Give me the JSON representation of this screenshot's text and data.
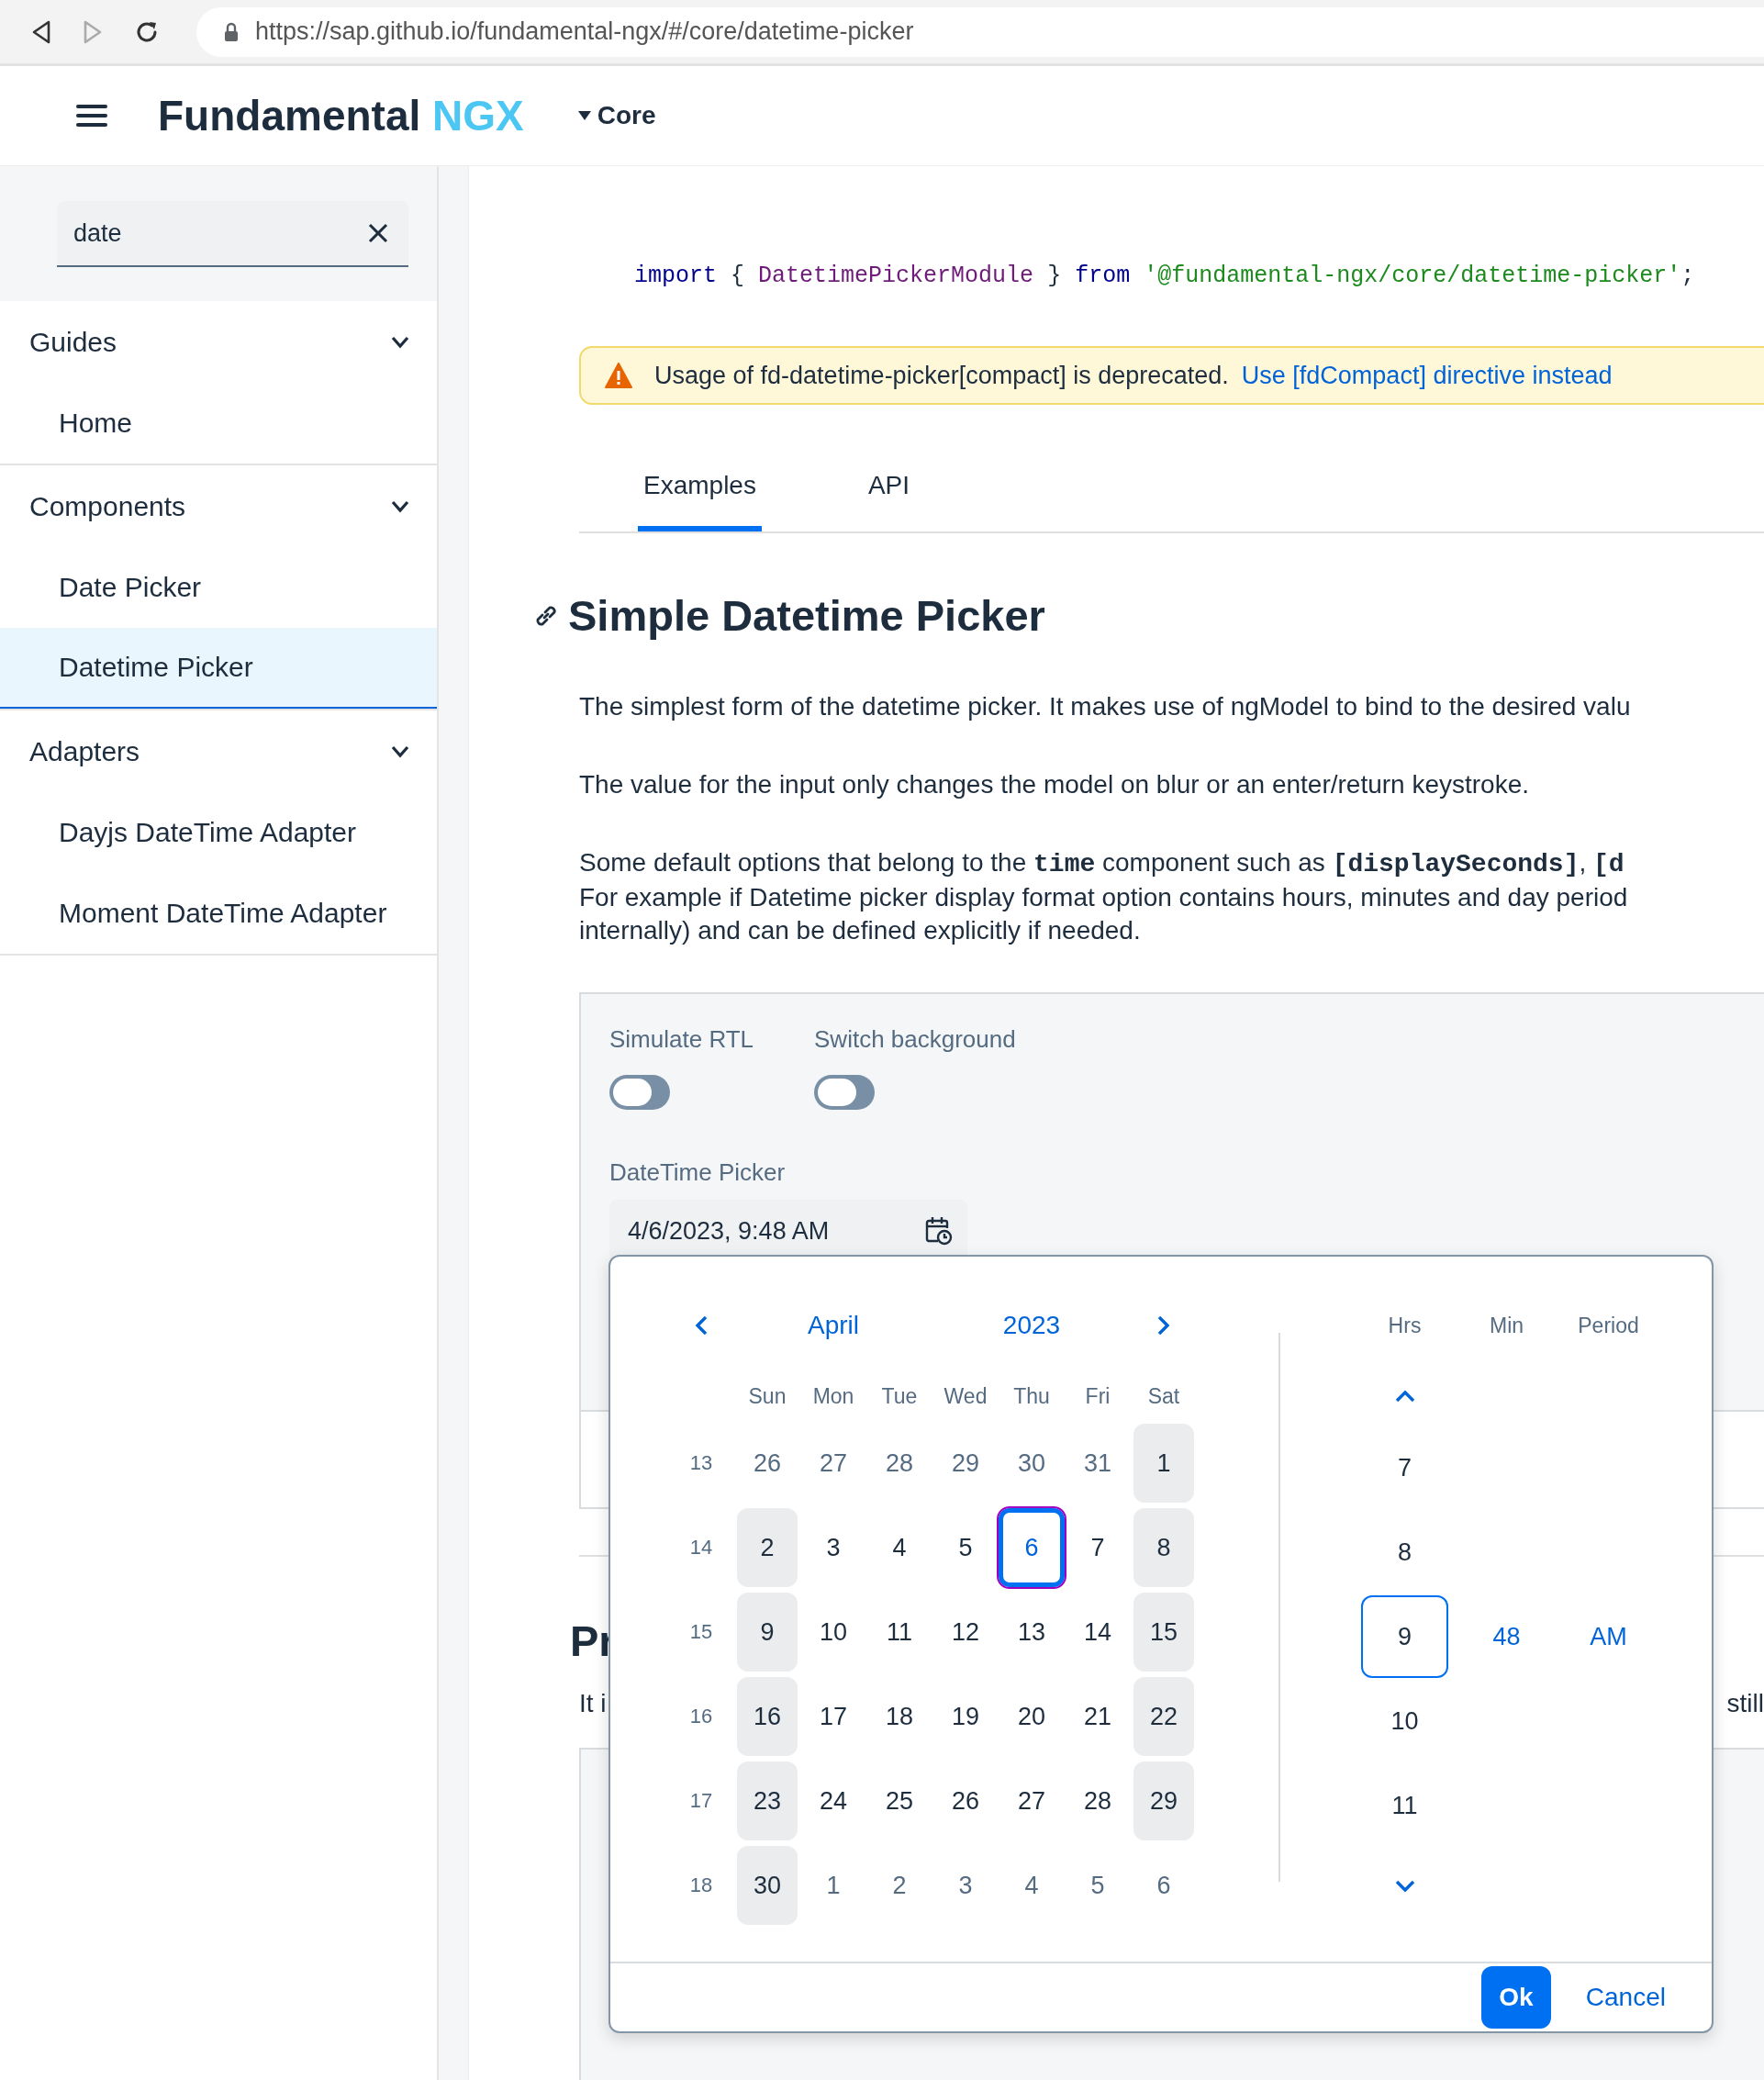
{
  "browser": {
    "nav_buttons": [
      {
        "kind": "back",
        "disabled": false
      },
      {
        "kind": "forward",
        "disabled": true
      },
      {
        "kind": "reload",
        "disabled": false
      }
    ],
    "url": "https://sap.github.io/fundamental-ngx/#/core/datetime-picker"
  },
  "header": {
    "brand": "Fundamental",
    "brand_accent": "NGX",
    "menu": "Core"
  },
  "sidebar": {
    "search": {
      "value": "date"
    },
    "groups": [
      {
        "label": "Guides",
        "expanded": true,
        "children": [
          {
            "label": "Home",
            "selected": false
          }
        ]
      },
      {
        "label": "Components",
        "expanded": true,
        "children": [
          {
            "label": "Date Picker",
            "selected": false
          },
          {
            "label": "Datetime Picker",
            "selected": true
          }
        ]
      },
      {
        "label": "Adapters",
        "expanded": true,
        "children": [
          {
            "label": "Dayjs DateTime Adapter",
            "selected": false
          },
          {
            "label": "Moment DateTime Adapter",
            "selected": false
          }
        ]
      }
    ]
  },
  "code_import": [
    {
      "kind": "keyword",
      "text": "import"
    },
    {
      "kind": "punct",
      "text": "{"
    },
    {
      "kind": "name",
      "text": "DatetimePickerModule"
    },
    {
      "kind": "punct",
      "text": "}"
    },
    {
      "kind": "keyword",
      "text": "from"
    },
    {
      "kind": "string",
      "text": "'@fundamental-ngx/core/datetime-picker'"
    },
    {
      "kind": "terminator",
      "text": ";"
    }
  ],
  "warning": {
    "text": "Usage of fd-datetime-picker[compact] is deprecated.",
    "link": "Use [fdCompact] directive instead"
  },
  "tabs": [
    {
      "label": "Examples",
      "selected": true
    },
    {
      "label": "API",
      "selected": false
    }
  ],
  "section": {
    "title": "Simple Datetime Picker",
    "paragraphs": [
      {
        "lines": [
          [
            {
              "text": "The simplest form of the datetime picker. It makes use of ngModel to bind to the desired valu",
              "code": false
            }
          ]
        ]
      },
      {
        "lines": [
          [
            {
              "text": "The value for the input only changes the model on blur or an enter/return keystroke.",
              "code": false
            }
          ]
        ]
      },
      {
        "lines": [
          [
            {
              "text": "Some default options that belong to the ",
              "code": false
            },
            {
              "text": "time",
              "code": true
            },
            {
              "text": " component such as ",
              "code": false
            },
            {
              "text": "[displaySeconds]",
              "code": true
            },
            {
              "text": ", ",
              "code": false
            },
            {
              "text": "[d",
              "code": true
            }
          ],
          [
            {
              "text": "For example if Datetime picker display format option contains hours, minutes and day period",
              "code": false
            }
          ],
          [
            {
              "text": "internally) and can be defined explicitly if needed.",
              "code": false
            }
          ]
        ]
      }
    ]
  },
  "example": {
    "toggles": [
      {
        "label": "Simulate RTL",
        "on": false
      },
      {
        "label": "Switch background",
        "on": false
      }
    ],
    "field_label": "DateTime Picker",
    "field_value": "4/6/2023, 9:48 AM"
  },
  "picker": {
    "month": "April",
    "year": "2023",
    "weekdays": [
      "Sun",
      "Mon",
      "Tue",
      "Wed",
      "Thu",
      "Fri",
      "Sat"
    ],
    "weeks": [
      {
        "number": "13",
        "days": [
          {
            "label": "26",
            "kind": "outside",
            "selected": false
          },
          {
            "label": "27",
            "kind": "outside",
            "selected": false
          },
          {
            "label": "28",
            "kind": "outside",
            "selected": false
          },
          {
            "label": "29",
            "kind": "outside",
            "selected": false
          },
          {
            "label": "30",
            "kind": "outside",
            "selected": false
          },
          {
            "label": "31",
            "kind": "outside",
            "selected": false
          },
          {
            "label": "1",
            "kind": "weekend",
            "selected": false
          }
        ]
      },
      {
        "number": "14",
        "days": [
          {
            "label": "2",
            "kind": "weekend",
            "selected": false
          },
          {
            "label": "3",
            "kind": "workday",
            "selected": false
          },
          {
            "label": "4",
            "kind": "workday",
            "selected": false
          },
          {
            "label": "5",
            "kind": "workday",
            "selected": false
          },
          {
            "label": "6",
            "kind": "workday",
            "selected": true
          },
          {
            "label": "7",
            "kind": "workday",
            "selected": false
          },
          {
            "label": "8",
            "kind": "weekend",
            "selected": false
          }
        ]
      },
      {
        "number": "15",
        "days": [
          {
            "label": "9",
            "kind": "weekend",
            "selected": false
          },
          {
            "label": "10",
            "kind": "workday",
            "selected": false
          },
          {
            "label": "11",
            "kind": "workday",
            "selected": false
          },
          {
            "label": "12",
            "kind": "workday",
            "selected": false
          },
          {
            "label": "13",
            "kind": "workday",
            "selected": false
          },
          {
            "label": "14",
            "kind": "workday",
            "selected": false
          },
          {
            "label": "15",
            "kind": "weekend",
            "selected": false
          }
        ]
      },
      {
        "number": "16",
        "days": [
          {
            "label": "16",
            "kind": "weekend",
            "selected": false
          },
          {
            "label": "17",
            "kind": "workday",
            "selected": false
          },
          {
            "label": "18",
            "kind": "workday",
            "selected": false
          },
          {
            "label": "19",
            "kind": "workday",
            "selected": false
          },
          {
            "label": "20",
            "kind": "workday",
            "selected": false
          },
          {
            "label": "21",
            "kind": "workday",
            "selected": false
          },
          {
            "label": "22",
            "kind": "weekend",
            "selected": false
          }
        ]
      },
      {
        "number": "17",
        "days": [
          {
            "label": "23",
            "kind": "weekend",
            "selected": false
          },
          {
            "label": "24",
            "kind": "workday",
            "selected": false
          },
          {
            "label": "25",
            "kind": "workday",
            "selected": false
          },
          {
            "label": "26",
            "kind": "workday",
            "selected": false
          },
          {
            "label": "27",
            "kind": "workday",
            "selected": false
          },
          {
            "label": "28",
            "kind": "workday",
            "selected": false
          },
          {
            "label": "29",
            "kind": "weekend",
            "selected": false
          }
        ]
      },
      {
        "number": "18",
        "days": [
          {
            "label": "30",
            "kind": "weekend",
            "selected": false
          },
          {
            "label": "1",
            "kind": "outside",
            "selected": false
          },
          {
            "label": "2",
            "kind": "outside",
            "selected": false
          },
          {
            "label": "3",
            "kind": "outside",
            "selected": false
          },
          {
            "label": "4",
            "kind": "outside",
            "selected": false
          },
          {
            "label": "5",
            "kind": "outside",
            "selected": false
          },
          {
            "label": "6",
            "kind": "outside",
            "selected": false
          }
        ]
      }
    ],
    "time": {
      "headers": [
        "Hrs",
        "Min",
        "Period"
      ],
      "hours": [
        {
          "label": "7",
          "selected": false
        },
        {
          "label": "8",
          "selected": false
        },
        {
          "label": "9",
          "selected": true
        },
        {
          "label": "10",
          "selected": false
        },
        {
          "label": "11",
          "selected": false
        }
      ],
      "minute": "48",
      "period": "AM"
    },
    "buttons": [
      {
        "label": "Ok",
        "kind": "primary"
      },
      {
        "label": "Cancel",
        "kind": "transparent"
      }
    ]
  },
  "next_section": {
    "title": "Pr",
    "text_start": "It i",
    "text_end": "still"
  }
}
